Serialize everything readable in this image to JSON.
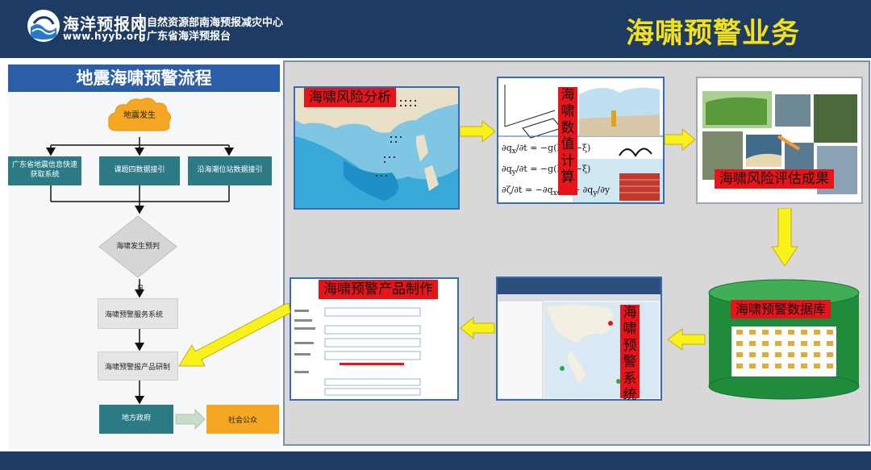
{
  "header": {
    "site_name": "海洋预报网",
    "site_url": "www.hyyb.org",
    "org_line1": "自然资源部南海预报减灾中心",
    "org_line2": "广东省海洋预报台",
    "title": "海啸预警业务"
  },
  "flow": {
    "title": "地震海啸预警流程",
    "start": "地震发生",
    "sources": [
      "广东省地震信息快速获取系统",
      "课题四数据接引",
      "沿海潮位站数据接引"
    ],
    "decision": "海啸发生预判",
    "yes": "是",
    "service_system": "海啸预警服务系统",
    "product_make": "海啸预警报产品研制",
    "government": "地方政府",
    "public": "社会公众"
  },
  "panels": {
    "risk_analysis": "海啸风险分析",
    "numerical": [
      "海",
      "啸",
      "数",
      "值",
      "计",
      "算"
    ],
    "assessment": "海啸风险评估成果",
    "database": "海啸预警数据库",
    "warning_system": [
      "海",
      "啸",
      "预",
      "警",
      "系",
      "统"
    ],
    "product": "海啸预警产品制作"
  },
  "colors": {
    "header_bg": "#1d3b63",
    "title_yellow": "#f2e11b",
    "flow_title_bg": "#2a5ea8",
    "teal": "#2b7a86",
    "orange": "#f5a623",
    "label_red": "#e8141a",
    "arrow_yellow": "#f7f21a",
    "db_green": "#1e8c3a"
  }
}
